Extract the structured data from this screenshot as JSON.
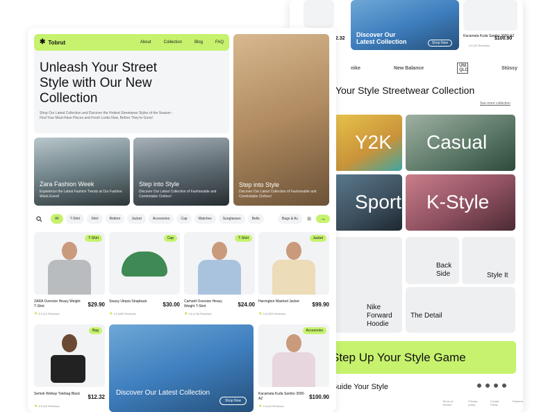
{
  "colors": {
    "accent": "#c6f26e",
    "text": "#111111",
    "muted": "#666666"
  },
  "back": {
    "top_left_price": "$2.32",
    "promo_top": {
      "label": "Discover Our Latest Collection",
      "button": "Shop Now"
    },
    "top_right": {
      "name": "Kacamata Kuda Sambo 3000-AZ",
      "price": "$100.90",
      "rating": "4.6 (23 Reviews)"
    },
    "brands": [
      "nike",
      "New Balance",
      "UNI QLO",
      "Stüssy"
    ],
    "section_title": "Your Style Streetwear Collection",
    "see_more": "See more collection",
    "styles": {
      "y2k": "Y2K",
      "casual": "Casual",
      "sport": "Sport",
      "kstyle": "K-Style"
    },
    "tiles": {
      "hoodie": "Nike Forward Hoodie",
      "back_side": "Back Side",
      "style_it": "Style It",
      "detail": "The Detail"
    },
    "cta": "Step Up Your Style Game",
    "footer_title": "Guide Your Style",
    "footer_links": [
      "Terms of Service",
      "Privacy policy",
      "Cookie Policy",
      "Partners"
    ]
  },
  "front": {
    "logo": "Tobrut",
    "nav": [
      "About",
      "Collection",
      "Blog",
      "FAQ"
    ],
    "hero_title": "Unleash Your Street Style with Our New Collection",
    "hero_sub": "Shop Our Latest Collection and Discover the Hottest Streetwear Styles of the Season - Find Your Must-Have Pieces and Fresh Looks Now, Before They're Gone!",
    "feature_1": {
      "title": "Zara Fashion Week",
      "sub": "Experience the Latest Fashion Trends at Our Fashion Week Event!"
    },
    "feature_2": {
      "title": "Step into Style",
      "sub": "Discover Our Latest Collection of Fashionable and Comfortable Clothes!"
    },
    "feature_3": {
      "title": "Step into Style",
      "sub": "Discover Our Latest Collection of Fashionable and Comfortable Clothes!"
    },
    "filters": [
      "All",
      "T-Shirt",
      "Shirt",
      "Bottom",
      "Jacket",
      "Accesories",
      "Cap",
      "Watches",
      "Sunglasses",
      "Belts",
      "Bags & Ac"
    ],
    "products": [
      {
        "tag": "T-Shirt",
        "name": "ZARA Oversize Heavy Weight T-Shirt",
        "price": "$29.90",
        "rating": "5.0 (12 Reviews)"
      },
      {
        "tag": "Cap",
        "name": "Stussy Utopia Strapback",
        "price": "$30.00",
        "rating": "4.5 (800 Reviews)"
      },
      {
        "tag": "T-Shirt",
        "name": "Carhartt Oversize Heavy Weight T-Shirt",
        "price": "$24.00",
        "rating": "4.6 (2.5k Reviews)"
      },
      {
        "tag": "Jacket",
        "name": "Harrington Washed Jacket",
        "price": "$99.90",
        "rating": "4.8 (520 Reviews)"
      },
      {
        "tag": "Bag",
        "name": "Semok Wolkay Totebag Black",
        "price": "$12.32",
        "rating": "5.0 (52 Reviews)"
      },
      {
        "tag": "Accesories",
        "name": "Kacamata Kuda Sambo 3000-AZ",
        "price": "$100.90",
        "rating": "4.6 (23 Reviews)"
      }
    ],
    "promo": {
      "label": "Discover Our Latest Collection",
      "button": "Shop Now"
    }
  }
}
